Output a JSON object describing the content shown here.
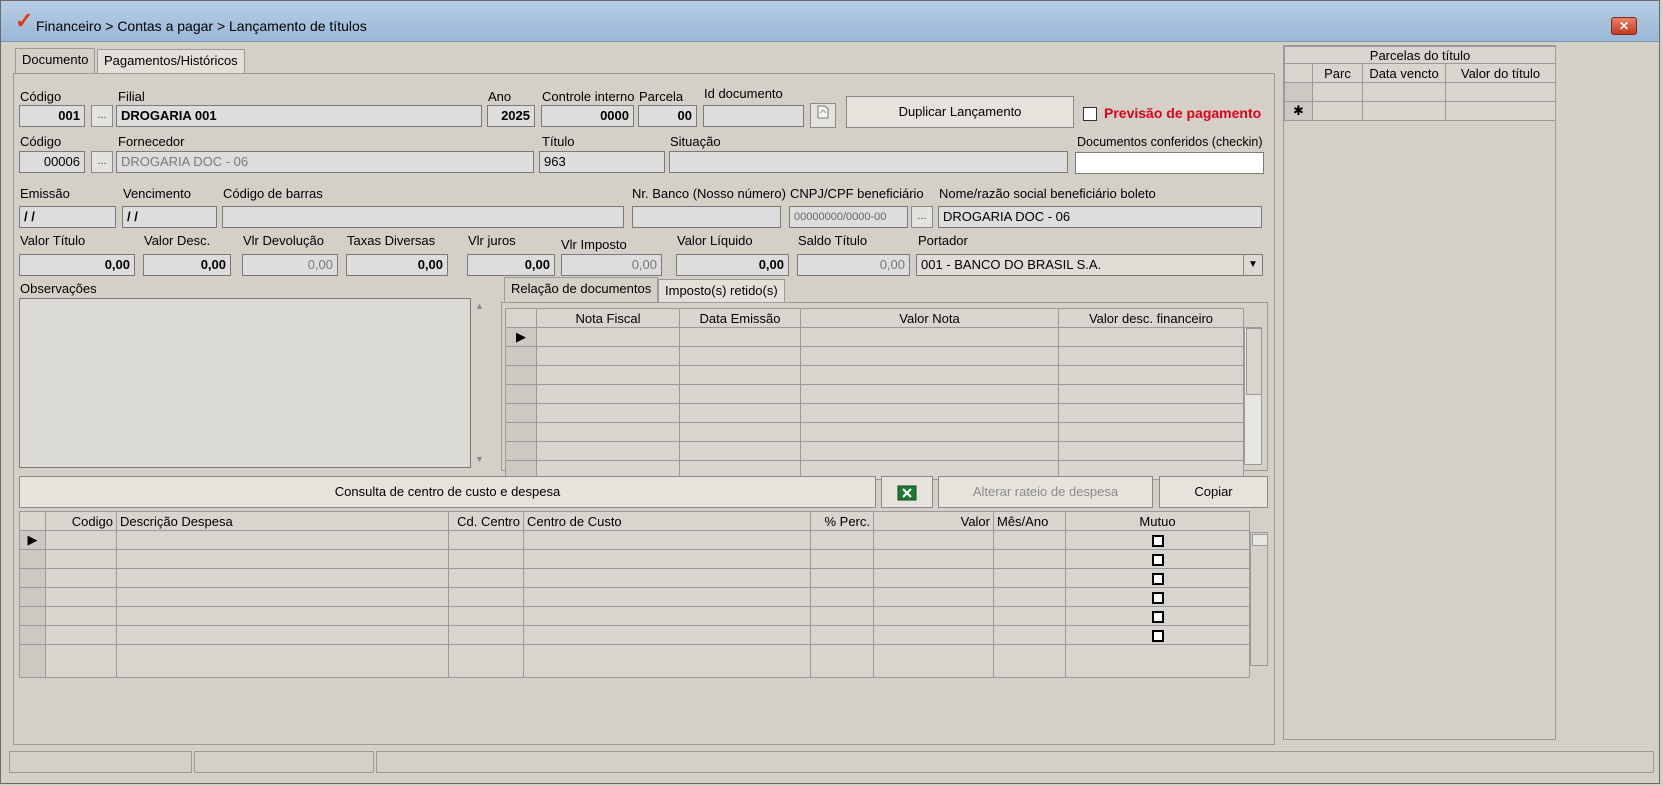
{
  "window": {
    "title": "Financeiro > Contas a pagar > Lançamento de títulos",
    "close_label": "✕"
  },
  "tabs": {
    "documento": "Documento",
    "pagamentos": "Pagamentos/Históricos"
  },
  "row1": {
    "codigo_label": "Código",
    "codigo_value": "001",
    "filial_label": "Filial",
    "filial_value": "DROGARIA 001",
    "ano_label": "Ano",
    "ano_value": "2025",
    "controle_label": "Controle interno",
    "controle_value": "0000",
    "parcela_label": "Parcela",
    "parcela_value": "00",
    "iddoc_label": "Id documento",
    "iddoc_value": "",
    "duplicar_label": "Duplicar Lançamento",
    "previsao_label": "Previsão de pagamento"
  },
  "row2": {
    "codigo_label": "Código",
    "codigo_value": "00006",
    "fornecedor_label": "Fornecedor",
    "fornecedor_value": "DROGARIA DOC - 06",
    "titulo_label": "Título",
    "titulo_value": "963",
    "situacao_label": "Situação",
    "situacao_value": "",
    "checkin_label": "Documentos conferidos (checkin)",
    "checkin_value": ""
  },
  "row3": {
    "emissao_label": "Emissão",
    "emissao_value": "/ /",
    "vencimento_label": "Vencimento",
    "vencimento_value": "/ /",
    "barras_label": "Código de barras",
    "barras_value": "",
    "nrbanco_label": "Nr. Banco (Nosso número)",
    "nrbanco_value": "",
    "cnpj_label": "CNPJ/CPF beneficiário",
    "cnpj_value": "00000000/0000-00",
    "nome_label": "Nome/razão social beneficiário boleto",
    "nome_value": "DROGARIA DOC - 06"
  },
  "row4": {
    "valor_titulo_label": "Valor Título",
    "valor_titulo": "0,00",
    "valor_desc_label": "Valor Desc.",
    "valor_desc": "0,00",
    "vlr_devolucao_label": "Vlr Devolução",
    "vlr_devolucao": "0,00",
    "taxas_label": "Taxas Diversas",
    "taxas": "0,00",
    "vlr_juros_label": "Vlr juros",
    "vlr_juros": "0,00",
    "vlr_imposto_label": "Vlr Imposto",
    "vlr_imposto": "0,00",
    "valor_liquido_label": "Valor Líquido",
    "valor_liquido": "0,00",
    "saldo_label": "Saldo Título",
    "saldo": "0,00",
    "portador_label": "Portador",
    "portador_value": "001 - BANCO DO BRASIL S.A."
  },
  "observacoes_label": "Observações",
  "doc_tabs": {
    "relacao": "Relação de documentos",
    "impostos": "Imposto(s) retido(s)"
  },
  "doc_grid": {
    "columns": [
      "Nota Fiscal",
      "Data Emissão",
      "Valor Nota",
      "Valor desc. financeiro"
    ]
  },
  "actions": {
    "consulta": "Consulta de centro de custo e despesa",
    "alterar": "Alterar rateio de despesa",
    "copiar": "Copiar"
  },
  "cost_grid": {
    "columns": [
      "Codigo",
      "Descrição Despesa",
      "Cd. Centro",
      "Centro de Custo",
      "% Perc.",
      "Valor",
      "Mês/Ano",
      "Mutuo"
    ]
  },
  "parcelas": {
    "title": "Parcelas do título",
    "columns": [
      "Parc",
      "Data vencto",
      "Valor do título"
    ]
  },
  "icons": {
    "title_logo": "check-logo-icon",
    "excel": "excel-icon",
    "dropdown": "chevron-down-icon",
    "row_pointer": "triangle-right-icon",
    "new_row": "asterisk-icon"
  },
  "colors": {
    "accent_red": "#e0001a",
    "titlebar": "#9bb8d8",
    "excel_green": "#1d7a35"
  }
}
